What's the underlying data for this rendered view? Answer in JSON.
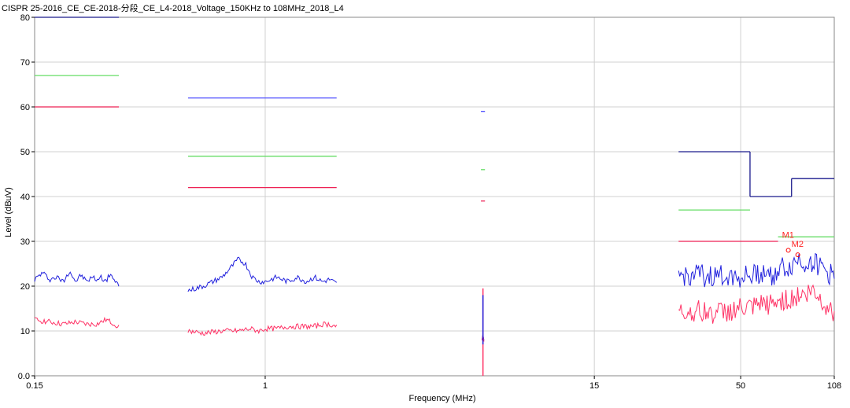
{
  "title": "CISPR 25-2016_CE_CE-2018-分段_CE_L4-2018_Voltage_150KHz to 108MHz_2018_L4",
  "chart_data": {
    "type": "line",
    "title": "CISPR 25-2016_CE_CE-2018-分段_CE_L4-2018_Voltage_150KHz to 108MHz_2018_L4",
    "xlabel": "Frequency (MHz)",
    "ylabel": "Level (dBuV)",
    "xscale": "log",
    "xlim": [
      0.15,
      108
    ],
    "ylim": [
      0,
      80
    ],
    "grid": true,
    "x_ticks": [
      {
        "value": 0.15,
        "label": "0.15"
      },
      {
        "value": 1,
        "label": "1"
      },
      {
        "value": 15,
        "label": "15"
      },
      {
        "value": 50,
        "label": "50"
      },
      {
        "value": 108,
        "label": "108"
      }
    ],
    "y_ticks": [
      {
        "value": 0,
        "label": "0.0"
      },
      {
        "value": 10,
        "label": "10"
      },
      {
        "value": 20,
        "label": "20"
      },
      {
        "value": 30,
        "label": "30"
      },
      {
        "value": 40,
        "label": "40"
      },
      {
        "value": 50,
        "label": "50"
      },
      {
        "value": 60,
        "label": "60"
      },
      {
        "value": 70,
        "label": "70"
      },
      {
        "value": 80,
        "label": "80"
      }
    ],
    "limit_lines": [
      {
        "color": "#1a1a8c",
        "segments": [
          [
            0.15,
            0.3,
            80
          ],
          [
            30,
            54,
            50
          ],
          [
            54,
            76,
            40
          ],
          [
            76,
            108,
            44
          ]
        ]
      },
      {
        "color": "#4a4aff",
        "segments": [
          [
            0.53,
            1.8,
            62
          ],
          [
            5.9,
            6.1,
            59
          ]
        ]
      },
      {
        "color": "#66dd66",
        "segments": [
          [
            0.15,
            0.3,
            67
          ],
          [
            0.53,
            1.8,
            49
          ],
          [
            5.9,
            6.1,
            46
          ],
          [
            30,
            54,
            37
          ],
          [
            68,
            108,
            31
          ]
        ]
      },
      {
        "color": "#ee2255",
        "segments": [
          [
            0.15,
            0.3,
            60
          ],
          [
            0.53,
            1.8,
            42
          ],
          [
            5.9,
            6.1,
            39
          ],
          [
            30,
            68,
            30
          ]
        ]
      }
    ],
    "series": [
      {
        "color": "#2222dd",
        "bands": [
          {
            "x": [
              0.15,
              0.16,
              0.17,
              0.18,
              0.19,
              0.2,
              0.21,
              0.22,
              0.23,
              0.24,
              0.25,
              0.26,
              0.27,
              0.28,
              0.29,
              0.3
            ],
            "y": [
              21.5,
              23,
              21.5,
              22,
              21,
              23.5,
              21,
              22.5,
              21,
              22,
              21.5,
              22,
              21,
              23,
              21,
              20
            ]
          },
          {
            "x": [
              0.53,
              0.6,
              0.7,
              0.75,
              0.8,
              0.85,
              0.9,
              0.95,
              1.0,
              1.1,
              1.2,
              1.3,
              1.4,
              1.5,
              1.6,
              1.7,
              1.8
            ],
            "y": [
              19,
              20,
              22,
              24,
              26,
              25,
              22,
              21,
              21,
              22,
              21,
              22,
              21,
              22,
              21,
              21.5,
              20.5
            ]
          },
          {
            "x": [
              5.95,
              6.0,
              6.05
            ],
            "y": [
              8,
              9,
              8.5
            ]
          },
          {
            "x": [
              30,
              35,
              40,
              45,
              50,
              55,
              60,
              65,
              70,
              75,
              80,
              85,
              90,
              95,
              100,
              108
            ],
            "y": [
              22,
              22.5,
              22,
              22.5,
              22,
              22.5,
              23,
              22.5,
              24,
              24,
              26,
              25,
              25.5,
              24.5,
              23.5,
              22
            ]
          }
        ]
      },
      {
        "color": "#ff3366",
        "bands": [
          {
            "x": [
              0.15,
              0.17,
              0.19,
              0.21,
              0.23,
              0.25,
              0.27,
              0.29,
              0.3
            ],
            "y": [
              12.5,
              12,
              11.5,
              12,
              11.5,
              11.5,
              12.5,
              11.5,
              11
            ]
          },
          {
            "x": [
              0.53,
              0.6,
              0.7,
              0.8,
              0.88,
              0.95,
              1.0,
              1.1,
              1.2,
              1.3,
              1.4,
              1.5,
              1.6,
              1.7,
              1.8
            ],
            "y": [
              10,
              9.5,
              10,
              10,
              10.5,
              10,
              10.5,
              10.5,
              11,
              11,
              11,
              11,
              11.5,
              11.5,
              11
            ]
          },
          {
            "x": [
              5.95,
              6.0,
              6.05
            ],
            "y": [
              8,
              9,
              8
            ]
          },
          {
            "x": [
              30,
              35,
              40,
              45,
              50,
              55,
              60,
              65,
              70,
              75,
              80,
              85,
              90,
              95,
              100,
              108
            ],
            "y": [
              14,
              14.5,
              14,
              14.5,
              15,
              15,
              16,
              16,
              17,
              17,
              18,
              18,
              19,
              17.5,
              16,
              14
            ]
          }
        ]
      }
    ],
    "markers": [
      {
        "label": "M1",
        "x": 74,
        "y": 28
      },
      {
        "label": "M2",
        "x": 80,
        "y": 27
      }
    ]
  }
}
